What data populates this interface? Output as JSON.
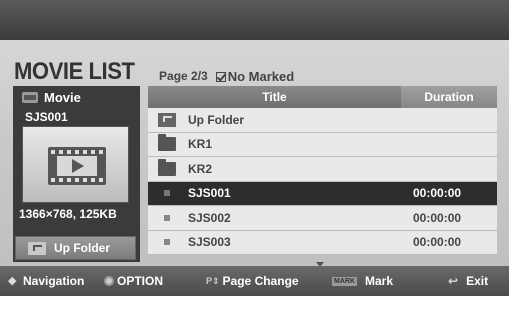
{
  "header": {
    "title": "MOVIE LIST",
    "page_info": "Page 2/3",
    "marked_info": "No Marked"
  },
  "preview": {
    "category": "Movie",
    "filename": "SJS001",
    "resolution": "1366×768, 125KB",
    "up_folder_label": "Up Folder"
  },
  "table": {
    "col_title": "Title",
    "col_duration": "Duration",
    "rows": [
      {
        "icon": "up-folder-icon",
        "title": "Up Folder",
        "duration": ""
      },
      {
        "icon": "folder-icon",
        "title": "KR1",
        "duration": ""
      },
      {
        "icon": "folder-icon",
        "title": "KR2",
        "duration": ""
      },
      {
        "icon": "file-icon",
        "title": "SJS001",
        "duration": "00:00:00",
        "selected": true
      },
      {
        "icon": "file-icon",
        "title": "SJS002",
        "duration": "00:00:00"
      },
      {
        "icon": "file-icon",
        "title": "SJS003",
        "duration": "00:00:00"
      }
    ]
  },
  "footer": {
    "navigation": "Navigation",
    "option": "OPTION",
    "page_change": "Page Change",
    "mark_icon_text": "MARK",
    "mark": "Mark",
    "exit": "Exit"
  }
}
